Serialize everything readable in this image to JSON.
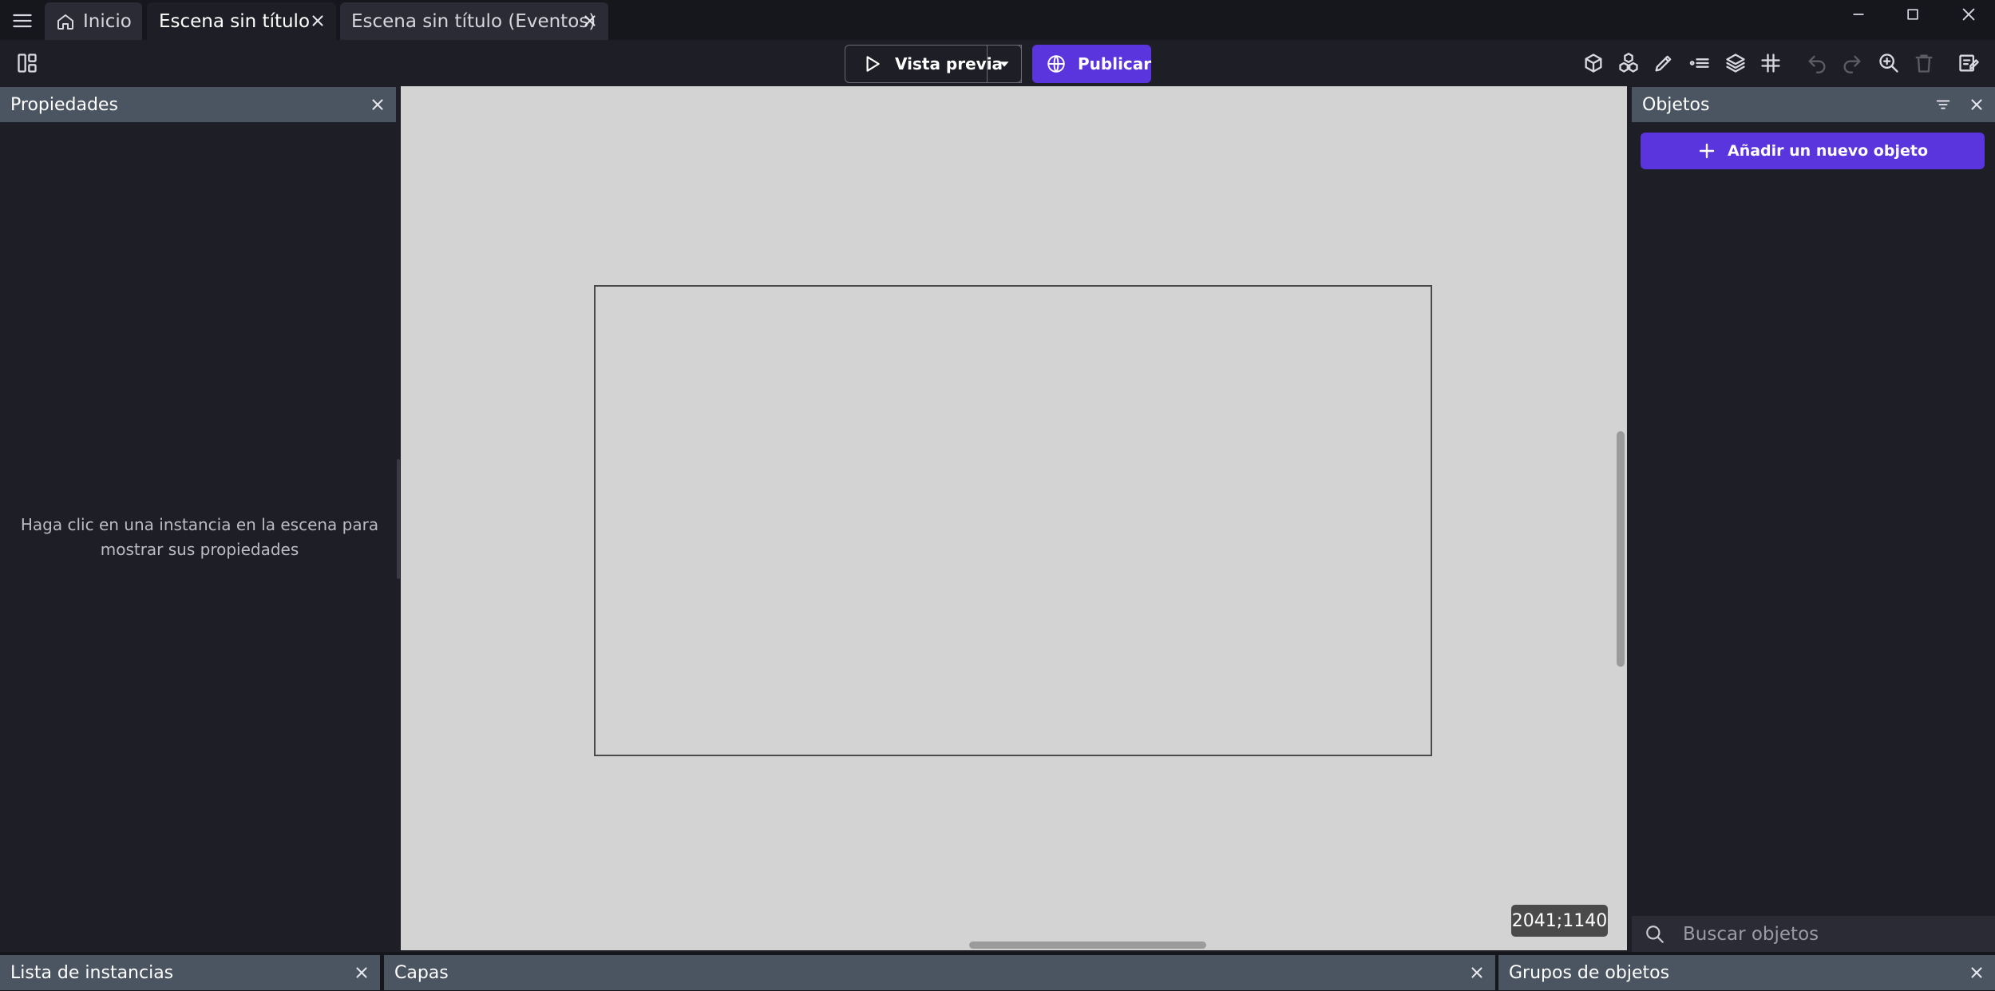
{
  "tabs": [
    {
      "label": "Inicio",
      "icon": "home-icon",
      "active": false
    },
    {
      "label": "Escena sin título",
      "active": true
    },
    {
      "label": "Escena sin título (Eventos)",
      "active": false
    }
  ],
  "toolbar": {
    "preview_label": "Vista previa",
    "publish_label": "Publicar"
  },
  "properties_panel": {
    "title": "Propiedades",
    "hint": "Haga clic en una instancia en la escena para mostrar sus propiedades"
  },
  "objects_panel": {
    "title": "Objetos",
    "add_label": "Añadir un nuevo objeto",
    "search_placeholder": "Buscar objetos"
  },
  "scene": {
    "coordinates": "2041;1140"
  },
  "bottom_panels": {
    "instances_title": "Lista de instancias",
    "layers_title": "Capas",
    "groups_title": "Grupos de objetos"
  },
  "colors": {
    "accent": "#5a34dc",
    "panel_header": "#4b5562",
    "canvas": "#d3d3d3"
  }
}
